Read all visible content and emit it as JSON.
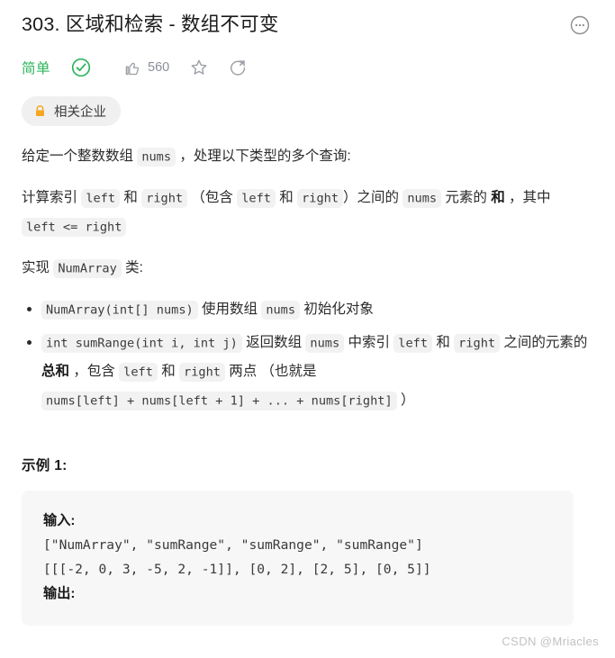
{
  "header": {
    "title": "303. 区域和检索 - 数组不可变",
    "more_icon": "more-horizontal-circle-icon"
  },
  "meta": {
    "difficulty": "简单",
    "difficulty_color": "#2db55d",
    "solved_icon": "check-circle-icon",
    "like_icon": "thumbs-up-icon",
    "like_count": "560",
    "favorite_icon": "star-icon",
    "share_icon": "share-icon"
  },
  "company_tag": {
    "lock_icon": "lock-icon",
    "lock_color": "#f5a623",
    "label": "相关企业"
  },
  "description": {
    "p1": {
      "t1": "给定一个整数数组 ",
      "c1": "nums",
      "t2": " ，处理以下类型的多个查询:"
    },
    "p2": {
      "t1": "计算索引 ",
      "c1": "left",
      "t2": " 和 ",
      "c2": "right",
      "t3": " （包含 ",
      "c3": "left",
      "t4": " 和 ",
      "c4": "right",
      "t5": "）之间的 ",
      "c5": "nums",
      "t6": " 元素的 ",
      "b1": "和",
      "t7": " ，其中 ",
      "c6": "left <= right"
    },
    "p3": {
      "t1": "实现 ",
      "c1": "NumArray",
      "t2": " 类:"
    }
  },
  "spec_list": [
    {
      "code1": "NumArray(int[] nums)",
      "text1": " 使用数组 ",
      "code2": "nums",
      "text2": " 初始化对象"
    },
    {
      "code1": "int sumRange(int i, int j)",
      "text1": " 返回数组 ",
      "code2": "nums",
      "text2": " 中索引 ",
      "code3": "left",
      "text3": " 和 ",
      "code4": "right",
      "text4": " 之间的元素的 ",
      "bold1": "总和",
      "text5": " ，包含 ",
      "code5": "left",
      "text6": " 和 ",
      "code6": "right",
      "text7": " 两点 （也就是 ",
      "code7": "nums[left] + nums[left + 1] + ... + nums[right]",
      "text8": " ）"
    }
  ],
  "example": {
    "heading": "示例 1:",
    "input_label": "输入:",
    "input_line1": "[\"NumArray\", \"sumRange\", \"sumRange\", \"sumRange\"]",
    "input_line2": "[[[-2, 0, 3, -5, 2, -1]], [0, 2], [2, 5], [0, 5]]",
    "output_label": "输出:"
  },
  "watermark": "CSDN @Mriacles"
}
